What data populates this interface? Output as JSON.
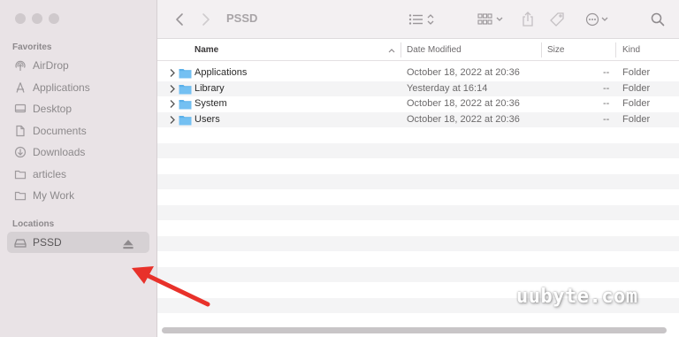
{
  "window": {
    "title": "PSSD"
  },
  "sidebar": {
    "favorites_heading": "Favorites",
    "favorites": [
      {
        "label": "AirDrop",
        "icon": "airdrop-icon"
      },
      {
        "label": "Applications",
        "icon": "applications-icon"
      },
      {
        "label": "Desktop",
        "icon": "desktop-icon"
      },
      {
        "label": "Documents",
        "icon": "document-icon"
      },
      {
        "label": "Downloads",
        "icon": "downloads-icon"
      },
      {
        "label": "articles",
        "icon": "folder-icon"
      },
      {
        "label": "My Work",
        "icon": "folder-icon"
      }
    ],
    "locations_heading": "Locations",
    "locations": [
      {
        "label": "PSSD",
        "icon": "drive-icon",
        "selected": true
      }
    ]
  },
  "columns": {
    "name": "Name",
    "date": "Date Modified",
    "size": "Size",
    "kind": "Kind"
  },
  "files": [
    {
      "name": "Applications",
      "date": "October 18, 2022 at 20:36",
      "size": "--",
      "kind": "Folder"
    },
    {
      "name": "Library",
      "date": "Yesterday at 16:14",
      "size": "--",
      "kind": "Folder"
    },
    {
      "name": "System",
      "date": "October 18, 2022 at 20:36",
      "size": "--",
      "kind": "Folder"
    },
    {
      "name": "Users",
      "date": "October 18, 2022 at 20:36",
      "size": "--",
      "kind": "Folder"
    }
  ],
  "watermark": "uubyte.com",
  "colors": {
    "accent_arrow": "#e8312a",
    "folder": "#5ab0ea",
    "sidebar_bg": "#e9e3e6"
  }
}
